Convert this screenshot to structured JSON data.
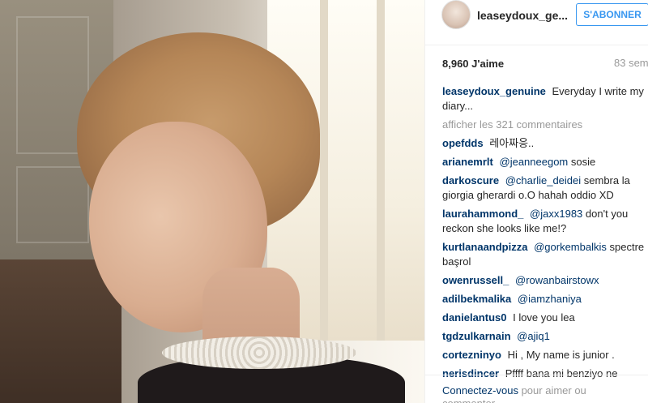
{
  "header": {
    "username": "leaseydoux_ge...",
    "follow_label": "S'ABONNER"
  },
  "post": {
    "likes": "8,960 J'aime",
    "time": "83 sem",
    "caption_user": "leaseydoux_genuine",
    "caption_text": "Everyday I write my diary...",
    "load_more": "afficher les 321 commentaires"
  },
  "comments": [
    {
      "user": "opefdds",
      "mention": "",
      "text": "레아짜응.."
    },
    {
      "user": "arianemrlt",
      "mention": "@jeanneegom",
      "text": "sosie"
    },
    {
      "user": "darkoscure",
      "mention": "@charlie_deidei",
      "text": "sembra la giorgia gherardi o.O hahah oddio XD"
    },
    {
      "user": "laurahammond_",
      "mention": "@jaxx1983",
      "text": "don't you reckon she looks like me!?"
    },
    {
      "user": "kurtlanaandpizza",
      "mention": "@gorkembalkis",
      "text": "spectre başrol"
    },
    {
      "user": "owenrussell_",
      "mention": "@rowanbairstowx",
      "text": ""
    },
    {
      "user": "adilbekmalika",
      "mention": "@iamzhaniya",
      "text": ""
    },
    {
      "user": "danielantus0",
      "mention": "",
      "text": "I love you lea"
    },
    {
      "user": "tgdzulkarnain",
      "mention": "@ajiq1",
      "text": ""
    },
    {
      "user": "cortezninyo",
      "mention": "",
      "text": "Hi , My name is junior ."
    },
    {
      "user": "nerisdincer",
      "mention": "",
      "text": "Pffff bana mi benziyo ne"
    }
  ],
  "footer": {
    "connect_link": "Connectez-vous",
    "connect_text": "pour aimer ou commenter."
  }
}
